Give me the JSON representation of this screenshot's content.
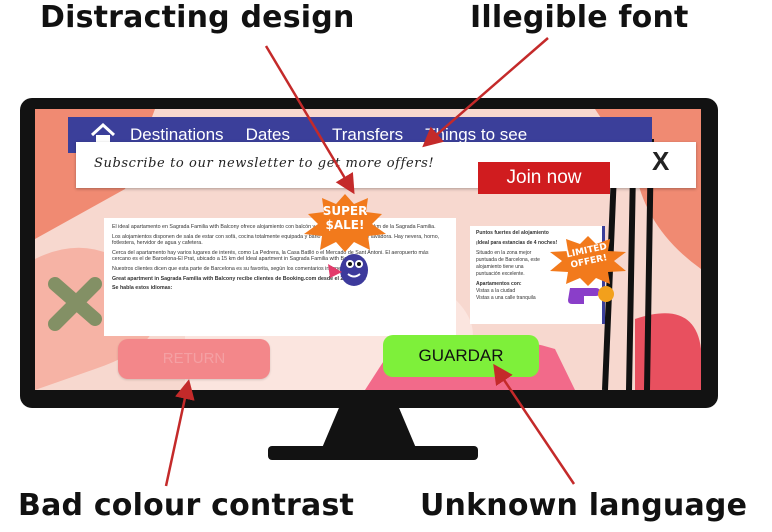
{
  "captions": {
    "distracting": "Distracting design",
    "illegible": "Illegible font",
    "contrast": "Bad colour contrast",
    "language": "Unknown language"
  },
  "nav": {
    "items": [
      "Destinations",
      "Dates",
      "Transfers",
      "Things to see"
    ]
  },
  "popup": {
    "text": "Subscribe to our newsletter to get more offers!",
    "close": "X",
    "join": "Join now"
  },
  "badges": {
    "super_sale_line1": "SUPER",
    "super_sale_line2": "$ALE!",
    "limited_line1": "LIMITED",
    "limited_line2": "OFFER!"
  },
  "content": {
    "paragraphs": [
      "El ideal apartamento en Sagrada Familia with Balcony ofrece alojamiento con balcón y wifi gratis a metros de 1 km de la Sagrada Familia.",
      "Los alojamientos disponen de sala de estar con sofá, cocina totalmente equipada y baño privado con ducha y lavadora. Hay nevera, horno, fotlestera, hervidor de agua y cafetera.",
      "Cerca del apartamento hay varios lugares de interés, como La Pedrera, la Casa Batlló o el Mercado de Sant Antoni. El aeropuerto más cercano es el de Barcelona-El Prat, ubicado a 15 km del Ideal apartment in Sagrada Familia with Balcony.",
      "Nuestros clientes dicen que esta parte de Barcelona es su favorita, según los comentarios independientes."
    ],
    "bold": "Great apartment in Sagrada Familia with Balcony recibe clientes de Booking.com desde el 2 jul 2014.",
    "idiomas": "Se habla estos idiomas:"
  },
  "side": {
    "title": "Puntos fuertes del alojamiento",
    "subtitle": "¡Ideal para estancias de 4 noches!",
    "location": "Situado en la zona mejor puntuada de Barcelona, este alojamiento tiene una puntuación excelente.",
    "apartment": "Apartamentos con:",
    "view1": "Vistas a la ciudad",
    "view2": "Vistas a una calle tranquila"
  },
  "buttons": {
    "left": "RETURN",
    "guardar": "GUARDAR"
  },
  "colors": {
    "nav": "#3b3f9a",
    "join": "#d01c1f",
    "guardar": "#7ef03a",
    "left_button": "#f3878a",
    "arrow": "#c42a2a"
  }
}
